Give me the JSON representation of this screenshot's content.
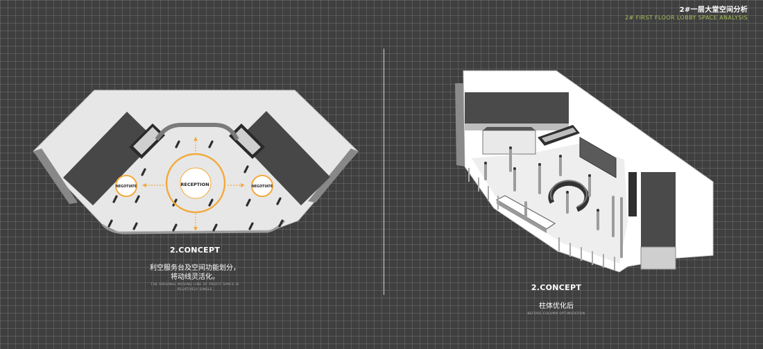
{
  "header": {
    "title": "2#一层大堂空间分析",
    "subtitle": "2# FIRST FLOOR LOBBY SPACE ANALYSIS"
  },
  "left_plan": {
    "labels": {
      "reception": "RECEPTION",
      "negotiate_left": "NEGOTIATE",
      "negotiate_right": "NEGOTIATE"
    },
    "caption": {
      "heading": "2.CONCEPT",
      "cn_line1": "利空服务台及空间功能划分，",
      "cn_line2": "将动线灵活化。",
      "en_line1": "THE ORIGINAL MOVING LINE OF PROFIT SPACE IS",
      "en_line2": "RELATIVELY SINGLE"
    }
  },
  "right_plan": {
    "caption": {
      "heading": "2.CONCEPT",
      "cn": "柱体优化后",
      "en": "BEFORE COLUMN OPTIMIZATION"
    }
  },
  "colors": {
    "background": "#3f3f3f",
    "accent_orange": "#f2a93b",
    "accent_green": "#a9c25a",
    "floor": "#e7e7e7",
    "dark_block": "#444444"
  }
}
